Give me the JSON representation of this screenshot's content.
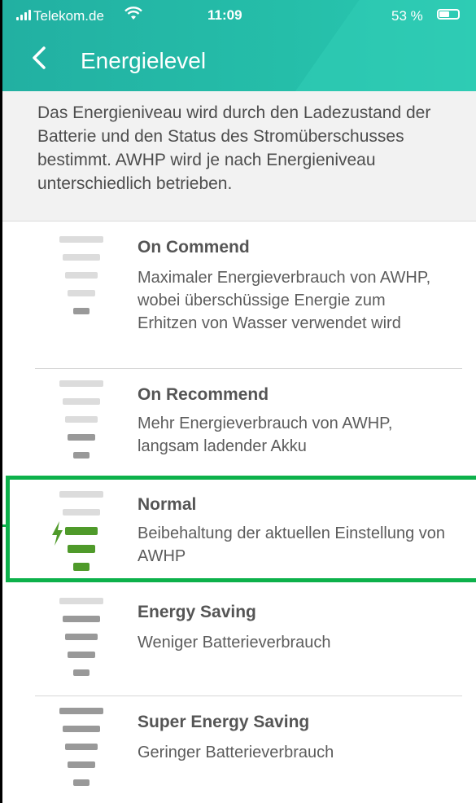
{
  "status_bar": {
    "carrier": "Telekom.de",
    "time": "11:09",
    "battery": "53 %"
  },
  "header": {
    "back_icon": "chevron-left-icon",
    "title": "Energielevel"
  },
  "intro": {
    "text": "Das Energieniveau wird durch den Ladezustand der Batterie und den Status des Stromüberschusses bestimmt. AWHP wird je nach Energieniveau unterschiedlich betrieben."
  },
  "levels": [
    {
      "label": "On Commend",
      "description": "Maximaler Energieverbrauch von AWHP, wobei überschüssige Energie zum Erhitzen von Wasser verwendet wird",
      "filled_bars": 1,
      "active": false
    },
    {
      "label": "On Recommend",
      "description": "Mehr Energieverbrauch von AWHP, langsam ladender Akku",
      "filled_bars": 2,
      "active": false
    },
    {
      "label": "Normal",
      "description": "Beibehaltung der aktuellen Einstellung von AWHP",
      "filled_bars": 3,
      "active": true
    },
    {
      "label": "Energy Saving",
      "description": "Weniger Batterieverbrauch",
      "filled_bars": 4,
      "active": false
    },
    {
      "label": "Super Energy Saving",
      "description": "Geringer Batterieverbrauch",
      "filled_bars": 5,
      "active": false
    }
  ],
  "colors": {
    "header_teal": "#25bea9",
    "bar_empty": "#dcdcdc",
    "bar_filled": "#999999",
    "bar_active": "#4f9a2a",
    "highlight_border": "#0db14b"
  }
}
